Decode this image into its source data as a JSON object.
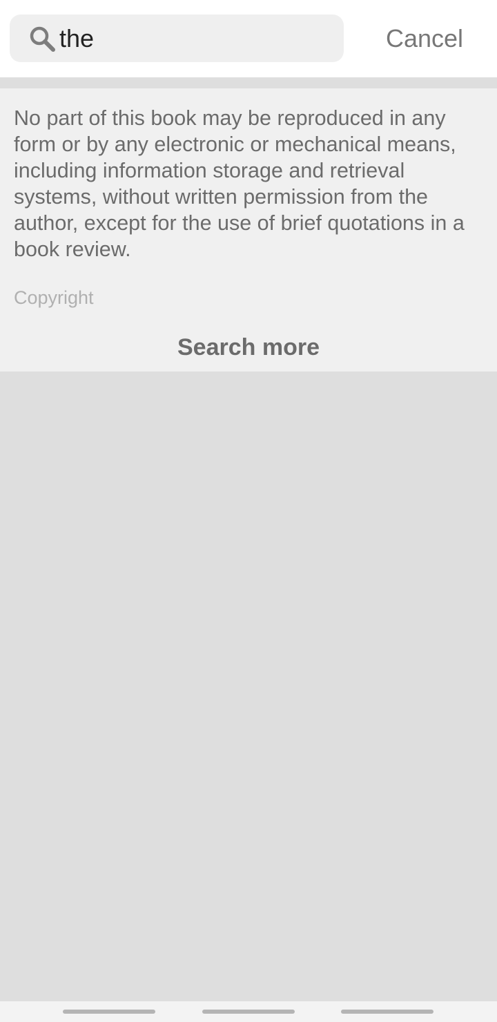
{
  "search": {
    "query": "the",
    "icon": "search-icon",
    "cancel_label": "Cancel"
  },
  "results": [
    {
      "snippet": "No part of this book may be reproduced in any form or by any electronic or mechanical means, including information storage and retrieval systems, without written permission from the author, except for the use of brief quotations in a book review.",
      "chapter": "Copyright"
    }
  ],
  "search_more_label": "Search more",
  "colors": {
    "background": "#dedede",
    "panel": "#f0f0f0",
    "text_muted": "#6b6b6b",
    "text_faint": "#b0b0b0"
  }
}
